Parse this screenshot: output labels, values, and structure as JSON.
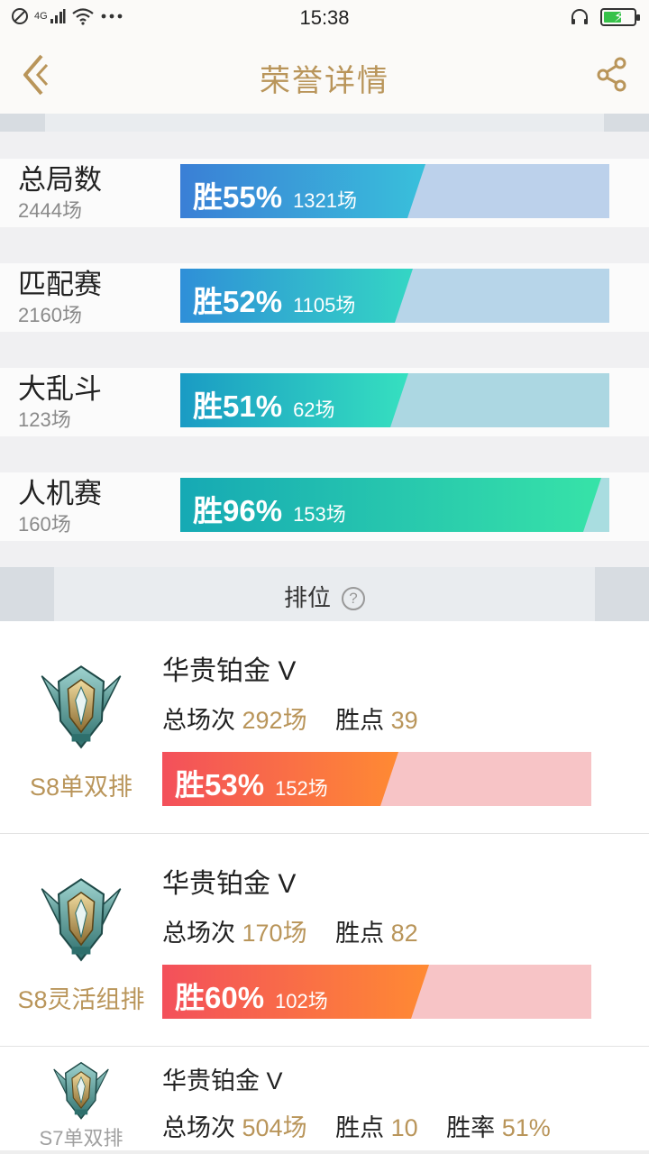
{
  "status_bar": {
    "time": "15:38",
    "network": "4G",
    "battery_level": 0.6,
    "icons": [
      "dnd-icon",
      "signal-icon",
      "wifi-icon",
      "more-icon",
      "headset-icon",
      "battery-icon"
    ]
  },
  "nav": {
    "title": "荣誉详情",
    "back_icon": "back-chevron-icon",
    "share_icon": "share-icon"
  },
  "stats": [
    {
      "name": "总局数",
      "count": "2444场",
      "win_label": "胜55%",
      "games": "1321场",
      "win_rate": 0.55,
      "fill_to": 0.55,
      "fill_from_color": "#3a7fd6",
      "fill_to_color": "#39c0db",
      "track_color": "#bcd1eb"
    },
    {
      "name": "匹配赛",
      "count": "2160场",
      "win_label": "胜52%",
      "games": "1105场",
      "win_rate": 0.52,
      "fill_to": 0.52,
      "fill_from_color": "#2f8fd8",
      "fill_to_color": "#34d6c4",
      "track_color": "#b7d5e9"
    },
    {
      "name": "大乱斗",
      "count": "123场",
      "win_label": "胜51%",
      "games": "62场",
      "win_rate": 0.51,
      "fill_to": 0.51,
      "fill_from_color": "#1a9bc4",
      "fill_to_color": "#36e0c0",
      "track_color": "#acd7e2"
    },
    {
      "name": "人机赛",
      "count": "160场",
      "win_label": "胜96%",
      "games": "153场",
      "win_rate": 0.96,
      "fill_to": 0.96,
      "fill_from_color": "#16a9b4",
      "fill_to_color": "#37e3a8",
      "track_color": "#a9dde0"
    }
  ],
  "ranked_section": {
    "title": "排位",
    "help_icon": "help-icon",
    "help_glyph": "?"
  },
  "ranked": [
    {
      "queue": "S8单双排",
      "tier": "华贵铂金 V",
      "total_label": "总场次",
      "total": "292场",
      "points_label": "胜点",
      "points": "39",
      "win_label": "胜53%",
      "games": "152场",
      "win_rate": 0.53,
      "fill_to": 0.53,
      "badge_icon": "platinum-rank-icon"
    },
    {
      "queue": "S8灵活组排",
      "tier": "华贵铂金 V",
      "total_label": "总场次",
      "total": "170场",
      "points_label": "胜点",
      "points": "82",
      "win_label": "胜60%",
      "games": "102场",
      "win_rate": 0.6,
      "fill_to": 0.6,
      "badge_icon": "platinum-rank-icon"
    },
    {
      "queue": "S7单双排",
      "tier": "华贵铂金 V",
      "total_label": "总场次",
      "total": "504场",
      "points_label": "胜点",
      "points": "10",
      "rate_label": "胜率",
      "rate": "51%",
      "badge_icon": "platinum-rank-icon"
    }
  ],
  "colors": {
    "gold": "#b9955a",
    "red_from": "#f3505b",
    "red_to": "#ff8a33",
    "red_track": "#f7c4c6"
  }
}
